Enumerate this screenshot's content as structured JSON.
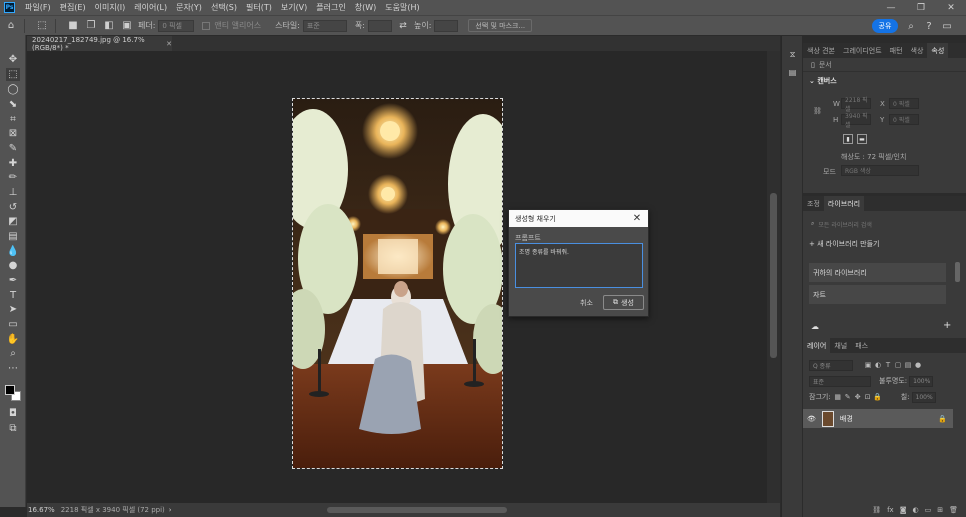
{
  "app": {
    "logo": "Ps",
    "menu": [
      "파일(F)",
      "편집(E)",
      "이미지(I)",
      "레이어(L)",
      "문자(Y)",
      "선택(S)",
      "필터(T)",
      "보기(V)",
      "플러그인",
      "창(W)",
      "도움말(H)"
    ]
  },
  "options": {
    "feather_label": "페더:",
    "feather_value": "0 픽셀",
    "antialias_label": "앤티 앨리어스",
    "style_label": "스타일:",
    "style_value": "표준",
    "width_label": "폭:",
    "height_label": "높이:",
    "select_mask": "선택 및 마스크...",
    "share": "공유"
  },
  "document": {
    "tab_title": "20240217_182749.jpg @ 16.7% (RGB/8*) *",
    "zoom": "16.67%",
    "doc_info": "2218 픽셀 x 3940 픽셀 (72 ppi)"
  },
  "dialog": {
    "title": "생성형 채우기",
    "prompt_label": "프롬프트",
    "prompt_value": "조명 종류를 바꿔줘.",
    "cancel": "취소",
    "generate": "생성"
  },
  "properties": {
    "tabs": [
      "색상 견본",
      "그레이디언트",
      "패턴",
      "색상",
      "속성"
    ],
    "active_tab": "속성",
    "doc_label": "문서",
    "canvas_section": "캔버스",
    "w_label": "W",
    "w_value": "2218 픽셀",
    "h_label": "H",
    "h_value": "3940 픽셀",
    "x_label": "X",
    "x_value": "0 픽셀",
    "y_label": "Y",
    "y_value": "0 픽셀",
    "resolution": "해상도 : 72 픽셀/인치",
    "mode_label": "모드",
    "mode_value": "RGB 색상"
  },
  "libraries": {
    "tabs": [
      "조정",
      "라이브러리"
    ],
    "active_tab": "라이브러리",
    "search_placeholder": "모든 라이브러리 검색",
    "create": "+ 새 라이브러리 만들기",
    "items": [
      "귀하의 라이브러리",
      "자트"
    ]
  },
  "layers": {
    "tabs": [
      "레이어",
      "채널",
      "패스"
    ],
    "active_tab": "레이어",
    "kind_label": "Q 종류",
    "blend_mode": "표준",
    "opacity_label": "불투명도:",
    "opacity_value": "100%",
    "lock_label": "잠그기:",
    "fill_label": "칠:",
    "fill_value": "100%",
    "layer_name": "배경"
  }
}
